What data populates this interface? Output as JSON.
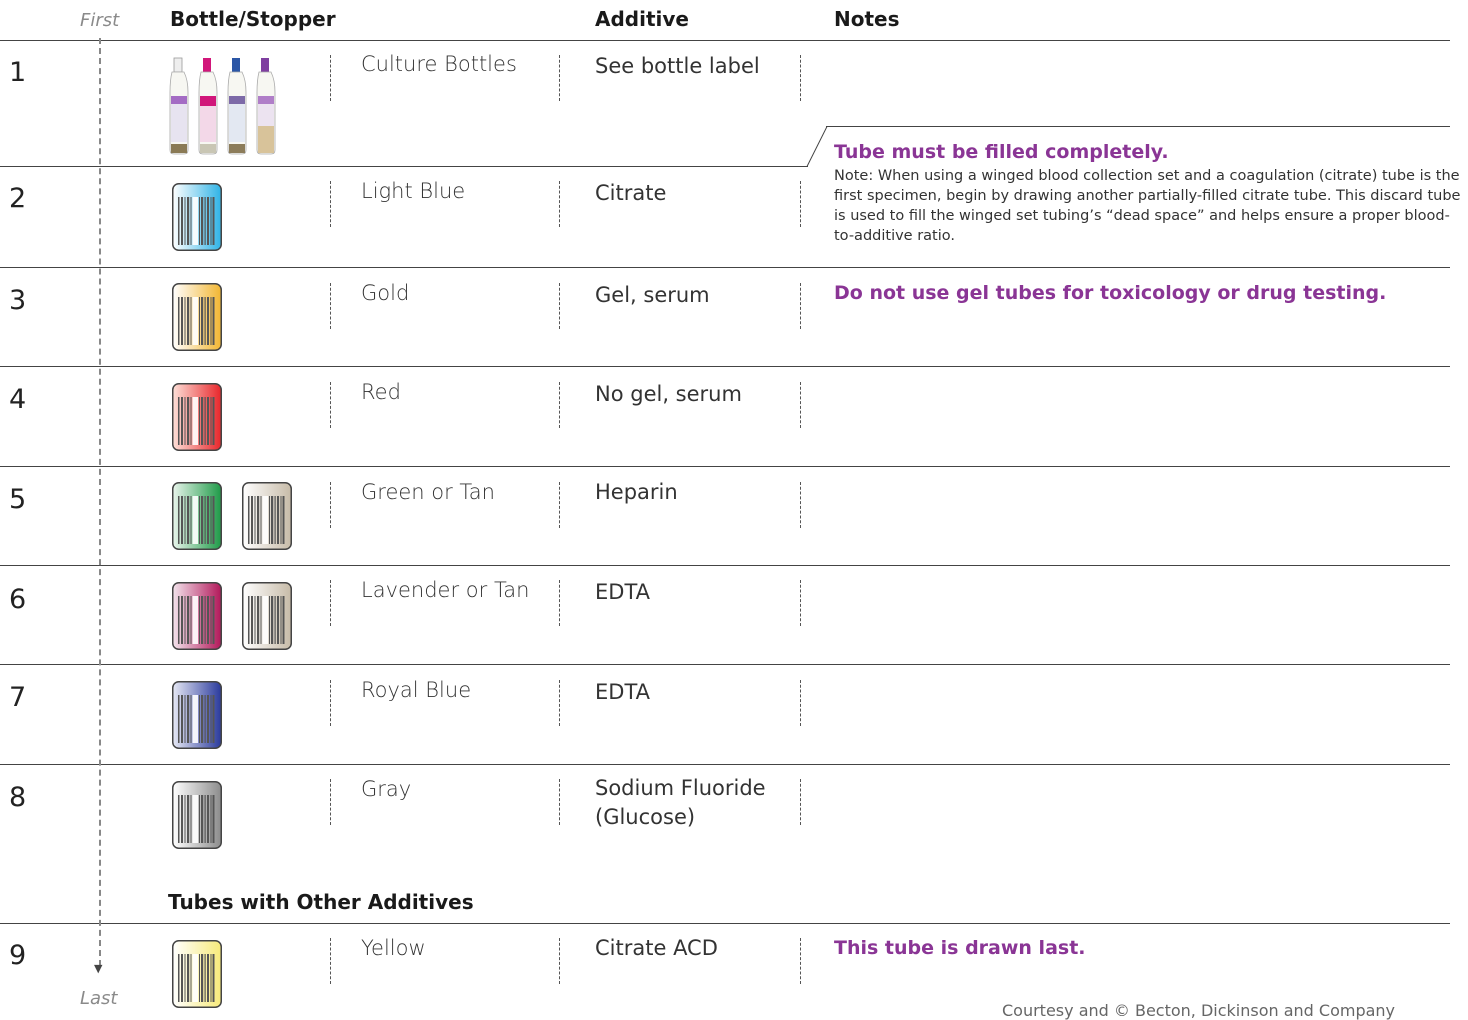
{
  "header": {
    "first_label": "First",
    "last_label": "Last",
    "col_bottle": "Bottle/Stopper",
    "col_additive": "Additive",
    "col_notes": "Notes"
  },
  "rows": [
    {
      "num": "1",
      "name": "Culture Bottles",
      "additive": "See bottle label"
    },
    {
      "num": "2",
      "name": "Light Blue",
      "additive": "Citrate",
      "note_strong": "Tube must be filled completely.",
      "note_body": "Note: When using a winged blood collection set and a coagulation (citrate) tube is the first specimen, begin by drawing another partially-filled citrate tube. This discard tube is used to fill the winged set tubing’s “dead space” and helps ensure a proper blood-to-additive ratio."
    },
    {
      "num": "3",
      "name": "Gold",
      "additive": "Gel, serum",
      "note_strong": "Do not use gel tubes for toxicology or drug testing."
    },
    {
      "num": "4",
      "name": "Red",
      "additive": "No gel, serum"
    },
    {
      "num": "5",
      "name": "Green or Tan",
      "additive": "Heparin"
    },
    {
      "num": "6",
      "name": "Lavender or Tan",
      "additive": "EDTA"
    },
    {
      "num": "7",
      "name": "Royal Blue",
      "additive": "EDTA"
    },
    {
      "num": "8",
      "name": "Gray",
      "additive_line1": "Sodium Fluoride",
      "additive_line2": "(Glucose)"
    },
    {
      "num": "9",
      "name": "Yellow",
      "additive": "Citrate ACD",
      "note_strong": "This tube is drawn last."
    }
  ],
  "subheading": "Tubes with Other Additives",
  "credit": "Courtesy and © Becton, Dickinson and Company",
  "colors": {
    "note_accent": "#8a3595",
    "light_blue": "#2fb3e6",
    "gold": "#f2b632",
    "red": "#e8262b",
    "green": "#1f9a48",
    "tan": "#c7bba8",
    "lavender": "#b2185a",
    "royal_blue": "#2a3a9c",
    "gray": "#8c8c8c",
    "yellow": "#f7ea7a"
  }
}
